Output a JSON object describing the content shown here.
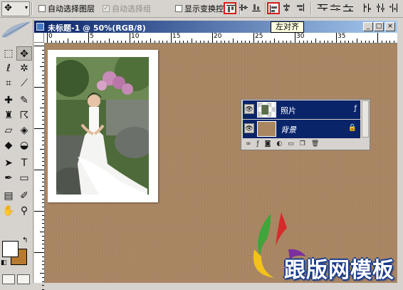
{
  "options_bar": {
    "tool_icon": "move-tool-icon",
    "auto_select_layer_label": "自动选择图层",
    "auto_select_group_label": "自动选择组",
    "show_transform_label": "显示变换控件",
    "auto_select_layer_checked": false,
    "auto_select_group_checked": true,
    "show_transform_checked": false
  },
  "document": {
    "title": "未标题-1 @ 50%(RGB/8)",
    "tooltip": "左对齐",
    "window_buttons": [
      "_",
      "□",
      "×"
    ],
    "ruler_h_labels": [
      "0",
      "5",
      "10",
      "15",
      "20",
      "25",
      "30",
      "35"
    ]
  },
  "layers_panel": {
    "layers": [
      {
        "name": "照片",
        "visible": true,
        "italic": false,
        "badge": "fx-icon"
      },
      {
        "name": "背景",
        "visible": true,
        "italic": true,
        "badge": "lock-icon"
      }
    ]
  },
  "colors": {
    "accent_highlight": "#d91c1c",
    "title_bar": "#0a246a",
    "canvas_background": "#a98562",
    "background_swatch": "#b57a30"
  },
  "watermark": {
    "text": "跟版网模板"
  }
}
